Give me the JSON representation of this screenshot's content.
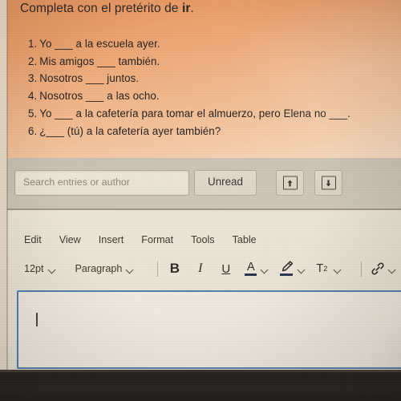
{
  "worksheet": {
    "title_prefix": "Completa con el pretérito de ",
    "title_verb": "ir",
    "title_suffix": ".",
    "questions": [
      {
        "num": "1.",
        "text": "Yo ___ a la escuela ayer."
      },
      {
        "num": "2.",
        "text": "Mis amigos ___ también."
      },
      {
        "num": "3.",
        "text": "Nosotros ___ juntos."
      },
      {
        "num": "4.",
        "text": "Nosotros ___ a las ocho."
      },
      {
        "num": "5.",
        "text": "Yo ___ a la cafetería para tomar el almuerzo, pero Elena no ___."
      },
      {
        "num": "6.",
        "text": "¿___ (tú) a la cafetería ayer también?"
      }
    ]
  },
  "search_bar": {
    "search_placeholder": "Search entries or author",
    "search_value": "",
    "unread_label": "Unread",
    "expand_icon": "arrow-up-in-box-icon",
    "collapse_icon": "arrow-down-in-box-icon"
  },
  "editor": {
    "menus": [
      "Edit",
      "View",
      "Insert",
      "Format",
      "Tools",
      "Table"
    ],
    "toolbar": {
      "font_size": "12pt",
      "block_format": "Paragraph",
      "bold_label": "B",
      "italic_label": "I",
      "underline_label": "U",
      "text_color_label": "A",
      "highlight_icon": "marker-pen-icon",
      "superscript_label": "T",
      "superscript_exponent": "2",
      "link_icon": "chain-link-icon",
      "chevron_icon": "chevron-down-icon"
    },
    "body_value": "",
    "focus_border_color": "#4d7fad"
  },
  "colors": {
    "card_top": "#e8955e",
    "card_bottom": "#f7dcc2",
    "toolbar_band": "#cdc4b7",
    "editor_bg": "#ece5d7",
    "text": "#241e1b",
    "accent_blue": "#4d7fad",
    "dark_band": "#211d1a"
  }
}
